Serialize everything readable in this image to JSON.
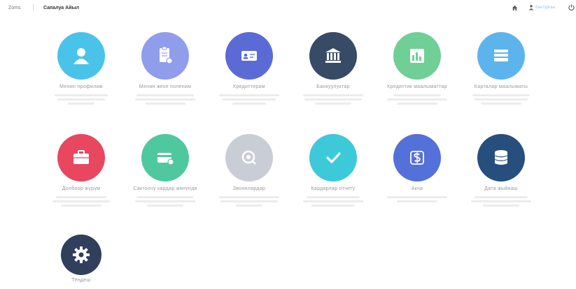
{
  "header": {
    "brand": "Zoms",
    "title": "Сапалуа Айыл",
    "user_name": "Бектурган"
  },
  "tiles": [
    {
      "label": "Менин профилим",
      "icon": "user-icon",
      "color": "#49c3e9"
    },
    {
      "label": "Менин жеке поленим",
      "icon": "clipboard-icon",
      "color": "#8f9dea"
    },
    {
      "label": "Кредиттерим",
      "icon": "id-card-icon",
      "color": "#5b6bd6"
    },
    {
      "label": "Банкуулуктар",
      "icon": "bank-icon",
      "color": "#374a66"
    },
    {
      "label": "Кредиттик маалыматтар",
      "icon": "bar-chart-icon",
      "color": "#6fcf97"
    },
    {
      "label": "Карталар маалыматы",
      "icon": "card-stack-icon",
      "color": "#5db4ec"
    },
    {
      "label": "Долбоор жүрүм",
      "icon": "briefcase-icon",
      "color": "#e8475f"
    },
    {
      "label": "Сактоочу кардар жөнүндө",
      "icon": "payment-card-icon",
      "color": "#4fc8a0"
    },
    {
      "label": "Звонилардар",
      "icon": "headset-icon",
      "color": "#c9ced6"
    },
    {
      "label": "Кардарлар отчету",
      "icon": "checkmark-icon",
      "color": "#3ec9da"
    },
    {
      "label": "Акча",
      "icon": "dollar-exchange-icon",
      "color": "#5470d9"
    },
    {
      "label": "Дата жыйнаш",
      "icon": "database-icon",
      "color": "#264f7d"
    },
    {
      "label": "Теңдеш",
      "icon": "gear-icon",
      "color": "#2f3f5c"
    }
  ]
}
